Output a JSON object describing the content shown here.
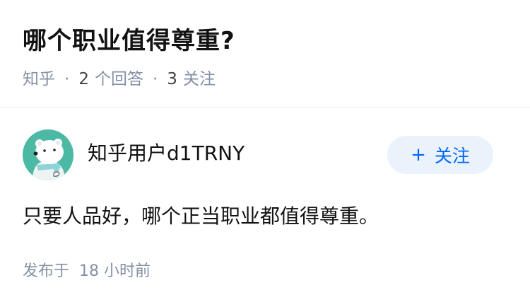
{
  "question": {
    "title": "哪个职业值得尊重?",
    "source": "知乎",
    "separator": "·",
    "answer_count": "2",
    "answer_label": "个回答",
    "follower_count": "3",
    "follower_label": "关注"
  },
  "answer": {
    "author_name": "知乎用户d1TRNY",
    "follow_button": {
      "plus": "+",
      "label": "关注"
    },
    "content": "只要人品好，哪个正当职业都值得尊重。",
    "published_prefix": "发布于",
    "published_time": "18 小时前"
  },
  "colors": {
    "accent": "#0066ff",
    "follow_bg": "#eaf2fb",
    "meta_text": "#8590a6",
    "avatar_bg": "#4cb9a4"
  }
}
